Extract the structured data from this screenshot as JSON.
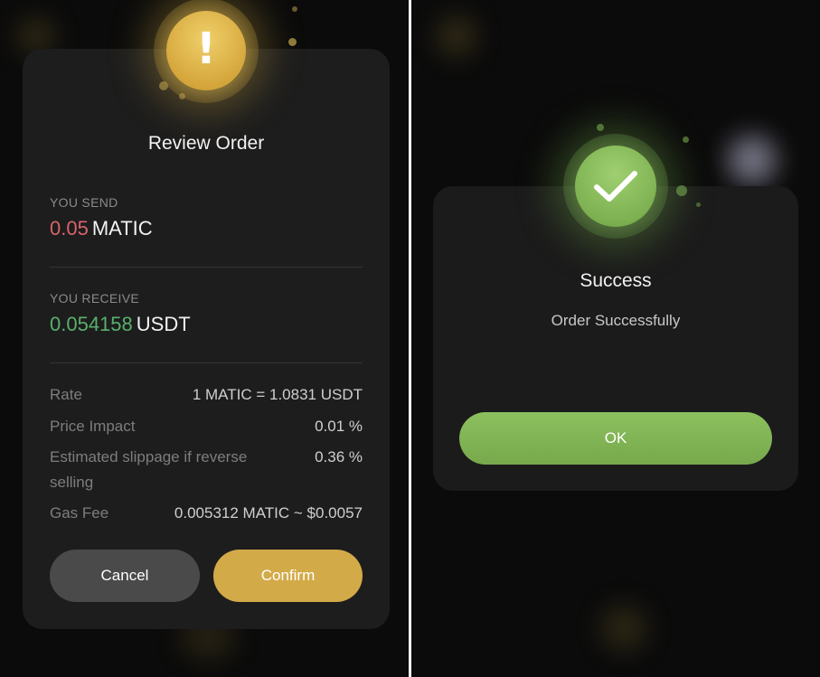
{
  "review": {
    "icon": "exclamation-icon",
    "icon_glyph": "!",
    "title": "Review Order",
    "send_label": "YOU SEND",
    "send_amount": "0.05",
    "send_symbol": "MATIC",
    "receive_label": "YOU RECEIVE",
    "receive_amount": "0.054158",
    "receive_symbol": "USDT",
    "details": [
      {
        "label": "Rate",
        "value": "1 MATIC = 1.0831 USDT"
      },
      {
        "label": "Price Impact",
        "value": "0.01 %"
      },
      {
        "label": "Estimated slippage if reverse selling",
        "value": "0.36 %"
      },
      {
        "label": "Gas Fee",
        "value": "0.005312 MATIC ~ $0.0057"
      }
    ],
    "cancel_label": "Cancel",
    "confirm_label": "Confirm"
  },
  "success": {
    "icon": "checkmark-icon",
    "title": "Success",
    "message": "Order Successfully",
    "ok_label": "OK"
  },
  "colors": {
    "accent_gold": "#d3aa48",
    "success_green": "#7db151",
    "send_red": "#d9636a",
    "receive_green": "#58b06c",
    "card_bg": "#1d1d1d"
  }
}
